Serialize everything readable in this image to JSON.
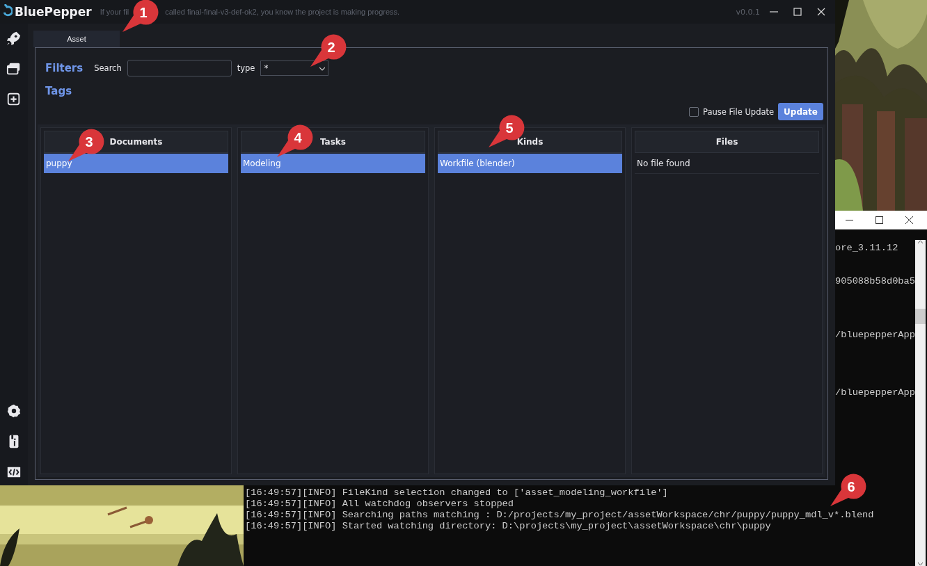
{
  "window": {
    "logo": "BluePepper",
    "tagline_parts": [
      "If your fil",
      "called final-final-v3-def-ok2, you know the project is making progress."
    ],
    "version": "v0.0.1"
  },
  "tabs": [
    {
      "label": "Asset",
      "selected": true
    }
  ],
  "filters": {
    "title": "Filters",
    "search_label": "Search",
    "type_label": "type",
    "type_value": "*"
  },
  "tags_title": "Tags",
  "pause_file_update": {
    "label": "Pause File Update",
    "checked": false
  },
  "update_button": "Update",
  "columns": [
    {
      "title": "Documents",
      "items": [
        {
          "label": "puppy",
          "selected": true
        }
      ]
    },
    {
      "title": "Tasks",
      "items": [
        {
          "label": "Modeling",
          "selected": true
        }
      ]
    },
    {
      "title": "Kinds",
      "items": [
        {
          "label": "Workfile (blender)",
          "selected": true
        }
      ]
    },
    {
      "title": "Files",
      "empty_message": "No file found"
    }
  ],
  "console": {
    "fragments": [
      "ore_3.11.12",
      "905088b58d0ba5",
      "/bluepepperApp",
      "/bluepepperApp"
    ],
    "lines": [
      "[16:49:57][INFO] FileKind selection changed to ['asset_modeling_workfile']",
      "[16:49:57][INFO] All watchdog observers stopped",
      "[16:49:57][INFO] Searching paths matching : D:/projects/my_project/assetWorkspace/chr/puppy/puppy_mdl_v*.blend",
      "[16:49:57][INFO] Started watching directory: D:\\projects\\my_project\\assetWorkspace\\chr\\puppy"
    ]
  },
  "callouts": [
    {
      "label": "1"
    },
    {
      "label": "2"
    },
    {
      "label": "3"
    },
    {
      "label": "4"
    },
    {
      "label": "5"
    },
    {
      "label": "6"
    }
  ]
}
